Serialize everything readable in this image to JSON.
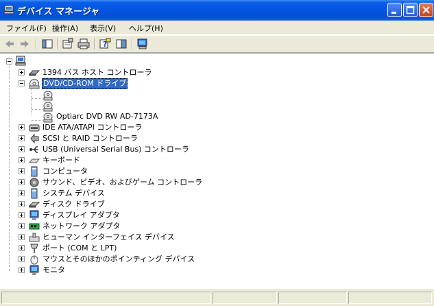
{
  "window": {
    "title": "デバイス マネージャ",
    "caption_buttons": [
      "minimize",
      "maximize",
      "close"
    ]
  },
  "menu": {
    "items": [
      "ファイル(F)",
      "操作(A)",
      "表示(V)",
      "ヘルプ(H)"
    ]
  },
  "toolbar": {
    "buttons": [
      "back-arrow-icon",
      "forward-arrow-icon",
      "show-hide-tree-icon",
      "properties-icon",
      "print-icon",
      "help-icon",
      "view-icon",
      "scan-hardware-icon"
    ]
  },
  "tree": {
    "root_label": "",
    "items": [
      {
        "label": "1394 バス ホスト コントローラ",
        "icon": "1394-controller-icon"
      },
      {
        "label": "DVD/CD-ROM ドライブ",
        "icon": "dvd-drive-icon",
        "expanded": true,
        "selected": true,
        "children": [
          {
            "label": "",
            "icon": "disc-icon"
          },
          {
            "label": "",
            "icon": "disc-icon"
          },
          {
            "label": "Optiarc DVD RW AD-7173A",
            "icon": "disc-icon"
          }
        ]
      },
      {
        "label": "IDE ATA/ATAPI コントローラ",
        "icon": "ide-controller-icon"
      },
      {
        "label": "SCSI と RAID コントローラ",
        "icon": "scsi-controller-icon"
      },
      {
        "label": "USB (Universal Serial Bus) コントローラ",
        "icon": "usb-icon"
      },
      {
        "label": "キーボード",
        "icon": "keyboard-icon"
      },
      {
        "label": "コンピュータ",
        "icon": "computer-icon"
      },
      {
        "label": "サウンド、ビデオ、およびゲーム コントローラ",
        "icon": "sound-icon"
      },
      {
        "label": "システム デバイス",
        "icon": "system-device-icon"
      },
      {
        "label": "ディスク ドライブ",
        "icon": "disk-drive-icon"
      },
      {
        "label": "ディスプレイ アダプタ",
        "icon": "display-adapter-icon"
      },
      {
        "label": "ネットワーク アダプタ",
        "icon": "network-adapter-icon"
      },
      {
        "label": "ヒューマン インターフェイス デバイス",
        "icon": "hid-icon"
      },
      {
        "label": "ポート (COM と LPT)",
        "icon": "port-icon"
      },
      {
        "label": "マウスとそのほかのポインティング デバイス",
        "icon": "mouse-icon"
      },
      {
        "label": "モニタ",
        "icon": "monitor-icon"
      }
    ]
  },
  "colors": {
    "titlebar": "#0454e0",
    "selection": "#316ac5",
    "chrome": "#ece9d8"
  }
}
